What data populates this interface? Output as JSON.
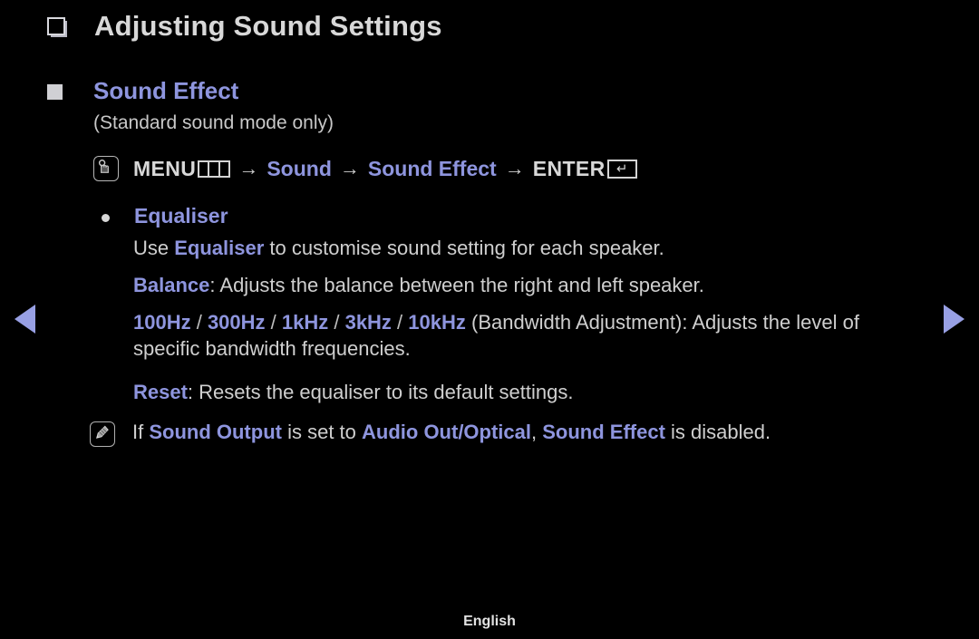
{
  "page": {
    "background_color": "#000000",
    "accent_color": "#8e95de",
    "text_color": "#cfcfcf",
    "title": "Adjusting Sound Settings",
    "title_icon": "stacked-square-icon"
  },
  "section": {
    "icon": "filled-square-icon",
    "heading": "Sound Effect",
    "subnote": "(Standard sound mode only)"
  },
  "menu_path": {
    "icon": "touch-hand-icon",
    "menu_label": "MENU",
    "menu_glyph": "menu-grid-glyph",
    "arrow": "→",
    "item1": "Sound",
    "item2": "Sound Effect",
    "enter_label": "ENTER",
    "enter_glyph": "↵"
  },
  "equaliser": {
    "bullet_icon": "dot-bullet-icon",
    "title": "Equaliser",
    "line1": {
      "pre": "Use ",
      "term": "Equaliser",
      "post": " to customise sound setting for each speaker."
    },
    "line2": {
      "term": "Balance",
      "post": ": Adjusts the balance between the right and left speaker."
    },
    "line3": {
      "freqs": [
        "100Hz",
        "300Hz",
        "1kHz",
        "3kHz",
        "10kHz"
      ],
      "separator": "/",
      "post": " (Bandwidth Adjustment): Adjusts the level of specific bandwidth frequencies."
    },
    "line4": {
      "term": "Reset",
      "post": ": Resets the equaliser to its default settings."
    }
  },
  "note": {
    "icon": "note-pencil-icon",
    "pre": "If ",
    "term1": "Sound Output",
    "mid1": " is set to ",
    "term2": "Audio Out/Optical",
    "mid2": ", ",
    "term3": "Sound Effect",
    "post": " is disabled."
  },
  "nav": {
    "prev_icon": "left-triangle-icon",
    "next_icon": "right-triangle-icon"
  },
  "footer": {
    "language": "English"
  }
}
